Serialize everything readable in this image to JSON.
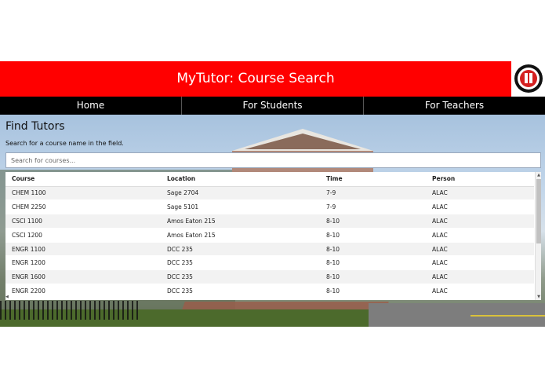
{
  "header": {
    "title": "MyTutor: Course Search"
  },
  "nav": {
    "items": [
      "Home",
      "For Students",
      "For Teachers"
    ]
  },
  "main": {
    "heading": "Find Tutors",
    "instruction": "Search for a course name in the field.",
    "search_placeholder": "Search for courses..."
  },
  "table": {
    "columns": [
      "Course",
      "Location",
      "Time",
      "Person"
    ],
    "rows": [
      [
        "CHEM 1100",
        "Sage 2704",
        "7-9",
        "ALAC"
      ],
      [
        "CHEM 2250",
        "Sage 5101",
        "7-9",
        "ALAC"
      ],
      [
        "CSCI 1100",
        "Amos Eaton 215",
        "8-10",
        "ALAC"
      ],
      [
        "CSCI 1200",
        "Amos Eaton 215",
        "8-10",
        "ALAC"
      ],
      [
        "ENGR 1100",
        "DCC 235",
        "8-10",
        "ALAC"
      ],
      [
        "ENGR 1200",
        "DCC 235",
        "8-10",
        "ALAC"
      ],
      [
        "ENGR 1600",
        "DCC 235",
        "8-10",
        "ALAC"
      ],
      [
        "ENGR 2200",
        "DCC 235",
        "8-10",
        "ALAC"
      ]
    ]
  },
  "colors": {
    "header": "#ff0000",
    "nav": "#000000"
  }
}
